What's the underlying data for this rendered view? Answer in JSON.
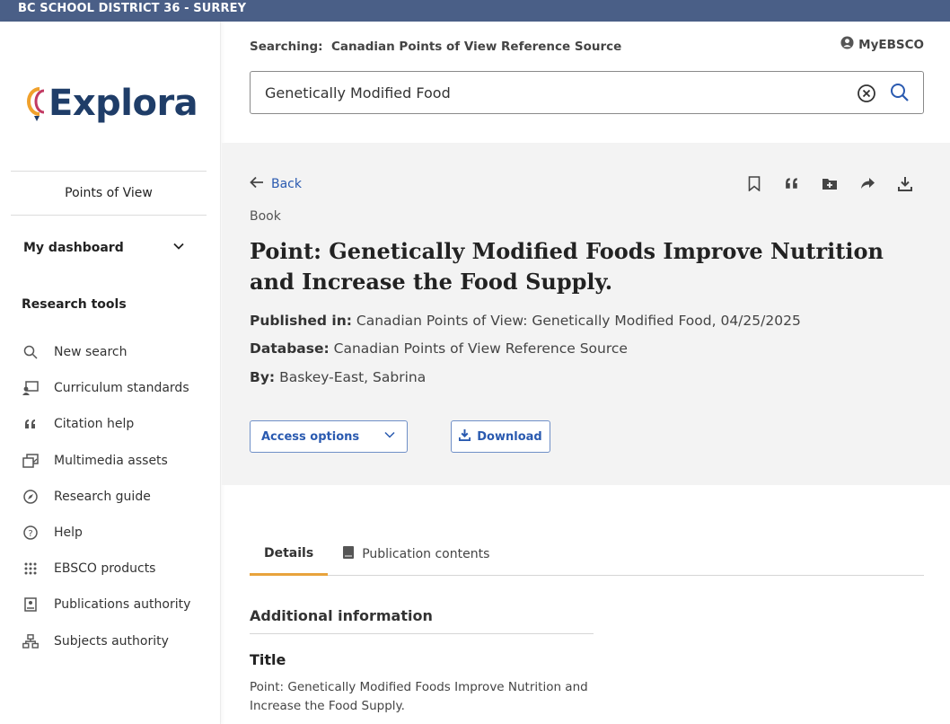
{
  "topbar": {
    "district": "BC SCHOOL DISTRICT 36 - SURREY"
  },
  "sidebar": {
    "logo_text": "Explora",
    "points_of_view": "Points of View",
    "dashboard": "My dashboard",
    "research_tools_heading": "Research tools",
    "tools": [
      {
        "label": "New search",
        "icon": "search-icon"
      },
      {
        "label": "Curriculum standards",
        "icon": "curriculum-icon"
      },
      {
        "label": "Citation help",
        "icon": "quote-icon"
      },
      {
        "label": "Multimedia assets",
        "icon": "multimedia-icon"
      },
      {
        "label": "Research guide",
        "icon": "compass-icon"
      },
      {
        "label": "Help",
        "icon": "help-icon"
      },
      {
        "label": "EBSCO products",
        "icon": "grid-icon"
      },
      {
        "label": "Publications authority",
        "icon": "publication-icon"
      },
      {
        "label": "Subjects authority",
        "icon": "hierarchy-icon"
      }
    ]
  },
  "header": {
    "searching_label": "Searching:",
    "searching_source": "Canadian Points of View Reference Source",
    "myebsco": "MyEBSCO",
    "search_value": "Genetically Modified Food"
  },
  "record": {
    "back": "Back",
    "type": "Book",
    "title": "Point: Genetically Modified Foods Improve Nutrition and Increase the Food Supply.",
    "published_label": "Published in:",
    "published_value": "Canadian Points of View: Genetically Modified Food, 04/25/2025",
    "database_label": "Database:",
    "database_value": "Canadian Points of View Reference Source",
    "by_label": "By:",
    "by_value": "Baskey-East, Sabrina",
    "access_options": "Access options",
    "download": "Download"
  },
  "tabs": [
    {
      "label": "Details",
      "active": true
    },
    {
      "label": "Publication contents",
      "active": false
    }
  ],
  "details": {
    "section_heading": "Additional information",
    "field_title_label": "Title",
    "field_title_value": "Point: Genetically Modified Foods Improve Nutrition and Increase the Food Supply."
  },
  "colors": {
    "topbar": "#4a5f87",
    "link": "#2a5ab0",
    "tab_accent": "#e8a33c",
    "logo": "#1f3d68"
  }
}
